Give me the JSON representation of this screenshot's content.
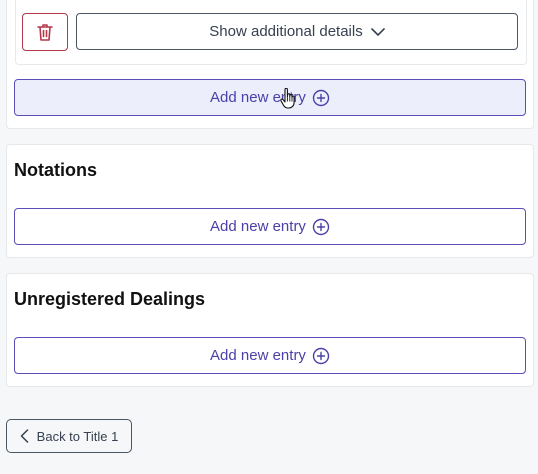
{
  "entry_card": {
    "delete_icon": "trash-icon",
    "details_label": "Show additional details",
    "details_icon": "chevron-down-icon"
  },
  "sections": [
    {
      "add_label": "Add new entry",
      "add_icon": "plus-circle-icon"
    },
    {
      "title": "Notations",
      "add_label": "Add new entry",
      "add_icon": "plus-circle-icon"
    },
    {
      "title": "Unregistered Dealings",
      "add_label": "Add new entry",
      "add_icon": "plus-circle-icon"
    }
  ],
  "footer": {
    "back_label": "Back to Title 1",
    "back_icon": "chevron-left-icon"
  },
  "colors": {
    "accent": "#4a40a8",
    "danger": "#b5374a",
    "hover_bg": "#eceefc"
  }
}
